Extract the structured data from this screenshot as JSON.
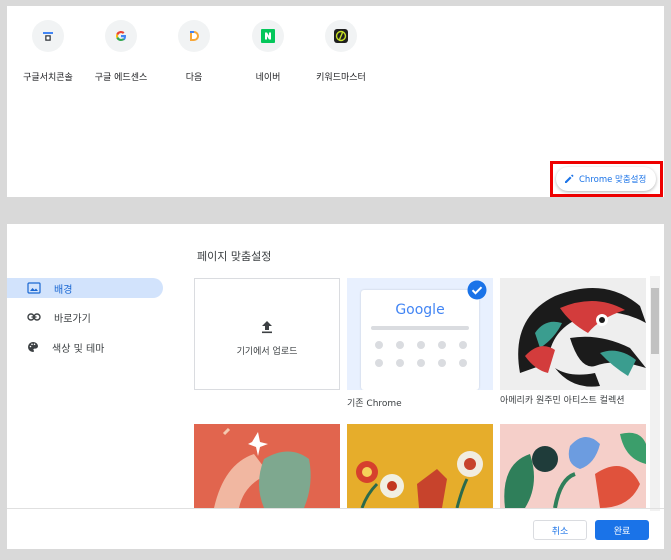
{
  "shortcuts": [
    {
      "label": "구글서치콘솔",
      "icon": "search-console-icon"
    },
    {
      "label": "구글 에드센스",
      "icon": "google-g-icon"
    },
    {
      "label": "다음",
      "icon": "daum-icon"
    },
    {
      "label": "네이버",
      "icon": "naver-icon"
    },
    {
      "label": "키워드마스터",
      "icon": "keyword-master-icon"
    }
  ],
  "customize": {
    "label": "Chrome 맞춤설정"
  },
  "dialog": {
    "title": "페이지 맞춤설정",
    "nav": [
      {
        "label": "배경",
        "icon": "background-icon",
        "active": true
      },
      {
        "label": "바로가기",
        "icon": "link-icon",
        "active": false
      },
      {
        "label": "색상 및 테마",
        "icon": "palette-icon",
        "active": false
      }
    ],
    "upload_label": "기기에서 업로드",
    "google_logo": "Google",
    "tiles": [
      {
        "label": "기존 Chrome"
      },
      {
        "label": "아메리카 원주민 아티스트 컬렉션"
      }
    ],
    "cancel_label": "취소",
    "done_label": "완료"
  },
  "colors": {
    "accent": "#1a73e8",
    "highlight_border": "#e00000",
    "nav_active_bg": "#d2e3fc"
  }
}
